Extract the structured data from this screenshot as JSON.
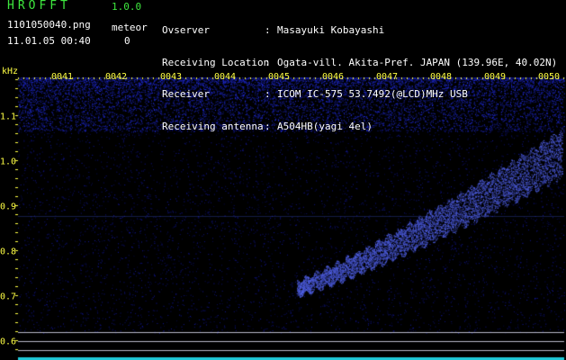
{
  "app": {
    "title": "HROFFT",
    "version": "1.0.0",
    "file_name": "1101050040.png",
    "date_time": "11.01.05 00:40",
    "meteor_label": "meteor",
    "meteor_count": "0"
  },
  "info": [
    {
      "key": "Ovserver",
      "sep": ":",
      "value": "Masayuki Kobayashi"
    },
    {
      "key": "Receiving Location",
      "sep": ":",
      "value": "Ogata-vill. Akita-Pref. JAPAN (139.96E, 40.02N)"
    },
    {
      "key": "Receiver",
      "sep": ":",
      "value": "ICOM IC-575 53.7492(@LCD)MHz USB"
    },
    {
      "key": "Receiving antenna",
      "sep": ":",
      "value": "A504HB(yagi 4el)"
    }
  ],
  "axes": {
    "y_unit": "kHz",
    "x_ticks": [
      "0041",
      "0042",
      "0043",
      "0044",
      "0045",
      "0046",
      "0047",
      "0048",
      "0049",
      "0050"
    ],
    "y_ticks": [
      "1.1",
      "1.0",
      "0.9",
      "0.8",
      "0.7",
      "0.6"
    ]
  },
  "colors": {
    "background": "#000000",
    "label_green": "#3ee83e",
    "tick_yellow": "#ffff44",
    "noise_blue": "#2233dd",
    "signal_blue": "#5a6bff"
  }
}
